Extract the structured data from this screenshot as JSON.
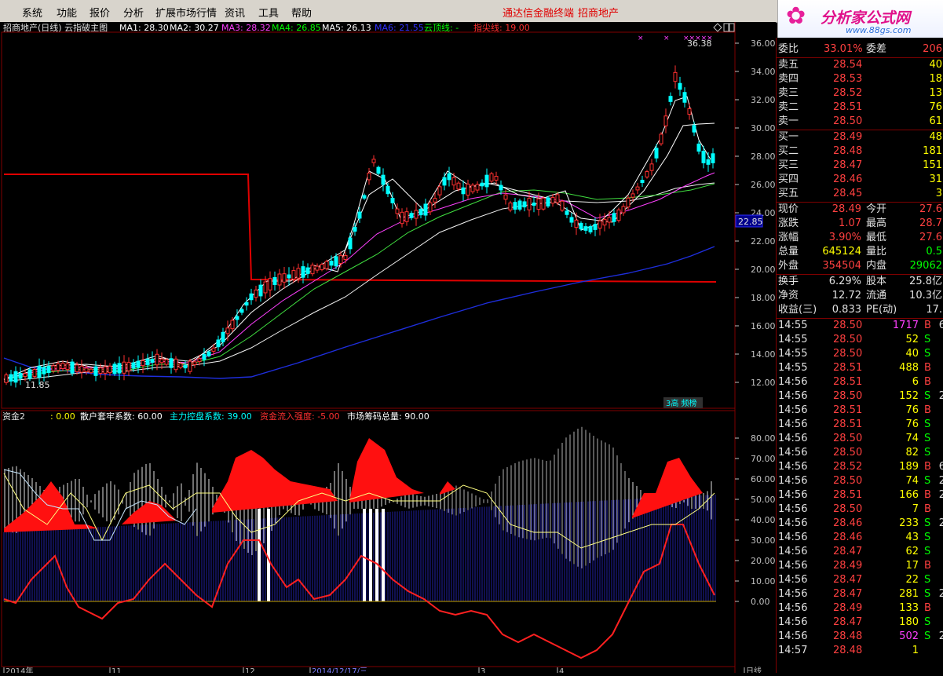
{
  "menu": {
    "items": [
      "系统",
      "功能",
      "报价",
      "分析",
      "扩展市场行情",
      "资讯",
      "工具",
      "帮助"
    ],
    "promo1": "通达信金融终端",
    "promo2": "招商地产"
  },
  "logo": {
    "brand": "分析家公式网",
    "url": "www.88gs.com"
  },
  "main_chart": {
    "title": "招商地产(日线) 云指破主图",
    "ma_labels": [
      {
        "text": "MA1: 28.30",
        "color": "#ffffff"
      },
      {
        "text": "MA2: 30.27",
        "color": "#ffffff"
      },
      {
        "text": "MA3: 28.32",
        "color": "#ff40ff"
      },
      {
        "text": "MA4: 26.85",
        "color": "#00ff00"
      },
      {
        "text": "MA5: 26.13",
        "color": "#ffffff"
      },
      {
        "text": "MA6: 21.55",
        "color": "#3030ff"
      },
      {
        "text": "云顶线: -",
        "color": "#00ff00"
      },
      {
        "text": "指尖线: 19.00",
        "color": "#ff3030"
      }
    ],
    "price_ticks": [
      "36.00",
      "34.00",
      "32.00",
      "30.00",
      "28.00",
      "26.00",
      "24.00",
      "22.00",
      "20.00",
      "18.00",
      "16.00",
      "14.00",
      "12.00"
    ],
    "high_label": "36.38",
    "low_label": "11.85",
    "current_tag": "22.85",
    "badge": "3高 频榜"
  },
  "sub_chart": {
    "title": "资金2",
    "labels": [
      {
        "text": ": 0.00",
        "color": "#ffff00"
      },
      {
        "text": "散户套牢系数: 60.00",
        "color": "#ffffff"
      },
      {
        "text": "主力控盘系数: 39.00",
        "color": "#00ffff"
      },
      {
        "text": "资金流入强度: -5.00",
        "color": "#ff3030"
      },
      {
        "text": "市场筹码总量: 90.00",
        "color": "#ffffff"
      }
    ],
    "ticks": [
      "80.00",
      "70.00",
      "60.00",
      "50.00",
      "40.00",
      "30.00",
      "20.00",
      "10.00",
      "0.00"
    ]
  },
  "bottom_axis": {
    "labels": [
      "2014年",
      "11",
      "12",
      "2014/12/17/三",
      "3",
      "4",
      "日线"
    ]
  },
  "quote": {
    "header": {
      "l1": "委比",
      "v1": "33.01%",
      "l2": "委差",
      "v2": "206"
    },
    "sell": [
      {
        "label": "卖五",
        "price": "28.54",
        "vol": "40"
      },
      {
        "label": "卖四",
        "price": "28.53",
        "vol": "18"
      },
      {
        "label": "卖三",
        "price": "28.52",
        "vol": "13"
      },
      {
        "label": "卖二",
        "price": "28.51",
        "vol": "76"
      },
      {
        "label": "卖一",
        "price": "28.50",
        "vol": "61"
      }
    ],
    "buy": [
      {
        "label": "买一",
        "price": "28.49",
        "vol": "48"
      },
      {
        "label": "买二",
        "price": "28.48",
        "vol": "181"
      },
      {
        "label": "买三",
        "price": "28.47",
        "vol": "151"
      },
      {
        "label": "买四",
        "price": "28.46",
        "vol": "31"
      },
      {
        "label": "买五",
        "price": "28.45",
        "vol": "3"
      }
    ],
    "stats1": [
      {
        "l1": "现价",
        "v1": "28.49",
        "c1": "red",
        "l2": "今开",
        "v2": "27.6",
        "c2": "red"
      },
      {
        "l1": "涨跌",
        "v1": "1.07",
        "c1": "red",
        "l2": "最高",
        "v2": "28.7",
        "c2": "red"
      },
      {
        "l1": "涨幅",
        "v1": "3.90%",
        "c1": "red",
        "l2": "最低",
        "v2": "27.6",
        "c2": "red"
      },
      {
        "l1": "总量",
        "v1": "645124",
        "c1": "yellow",
        "l2": "量比",
        "v2": "0.5",
        "c2": "green"
      },
      {
        "l1": "外盘",
        "v1": "354504",
        "c1": "red",
        "l2": "内盘",
        "v2": "29062",
        "c2": "green"
      }
    ],
    "stats2": [
      {
        "l1": "换手",
        "v1": "6.29%",
        "l2": "股本",
        "v2": "25.8亿"
      },
      {
        "l1": "净资",
        "v1": "12.72",
        "l2": "流通",
        "v2": "10.3亿"
      },
      {
        "l1": "收益(三)",
        "v1": "0.833",
        "l2": "PE(动)",
        "v2": "17."
      }
    ],
    "ticks": [
      {
        "t": "14:55",
        "p": "28.50",
        "v": "1717",
        "s": "B",
        "n": "6",
        "vc": "magenta"
      },
      {
        "t": "14:55",
        "p": "28.50",
        "v": "52",
        "s": "S",
        "n": "",
        "vc": "yellow"
      },
      {
        "t": "14:55",
        "p": "28.50",
        "v": "40",
        "s": "S",
        "n": "",
        "vc": "yellow"
      },
      {
        "t": "14:55",
        "p": "28.51",
        "v": "488",
        "s": "B",
        "n": "",
        "vc": "yellow"
      },
      {
        "t": "14:56",
        "p": "28.51",
        "v": "6",
        "s": "B",
        "n": "",
        "vc": "yellow"
      },
      {
        "t": "14:56",
        "p": "28.50",
        "v": "152",
        "s": "S",
        "n": "2",
        "vc": "yellow"
      },
      {
        "t": "14:56",
        "p": "28.51",
        "v": "76",
        "s": "B",
        "n": "",
        "vc": "yellow"
      },
      {
        "t": "14:56",
        "p": "28.51",
        "v": "76",
        "s": "S",
        "n": "",
        "vc": "yellow"
      },
      {
        "t": "14:56",
        "p": "28.50",
        "v": "74",
        "s": "S",
        "n": "",
        "vc": "yellow"
      },
      {
        "t": "14:56",
        "p": "28.50",
        "v": "82",
        "s": "S",
        "n": "",
        "vc": "yellow"
      },
      {
        "t": "14:56",
        "p": "28.52",
        "v": "189",
        "s": "B",
        "n": "6",
        "vc": "yellow"
      },
      {
        "t": "14:56",
        "p": "28.50",
        "v": "74",
        "s": "S",
        "n": "2",
        "vc": "yellow"
      },
      {
        "t": "14:56",
        "p": "28.51",
        "v": "166",
        "s": "B",
        "n": "2",
        "vc": "yellow"
      },
      {
        "t": "14:56",
        "p": "28.50",
        "v": "7",
        "s": "B",
        "n": "",
        "vc": "yellow"
      },
      {
        "t": "14:56",
        "p": "28.46",
        "v": "233",
        "s": "S",
        "n": "2",
        "vc": "yellow"
      },
      {
        "t": "14:56",
        "p": "28.46",
        "v": "43",
        "s": "S",
        "n": "",
        "vc": "yellow"
      },
      {
        "t": "14:56",
        "p": "28.47",
        "v": "62",
        "s": "S",
        "n": "",
        "vc": "yellow"
      },
      {
        "t": "14:56",
        "p": "28.49",
        "v": "17",
        "s": "B",
        "n": "",
        "vc": "yellow"
      },
      {
        "t": "14:56",
        "p": "28.47",
        "v": "22",
        "s": "S",
        "n": "",
        "vc": "yellow"
      },
      {
        "t": "14:56",
        "p": "28.47",
        "v": "281",
        "s": "S",
        "n": "2",
        "vc": "yellow"
      },
      {
        "t": "14:56",
        "p": "28.49",
        "v": "133",
        "s": "B",
        "n": "",
        "vc": "yellow"
      },
      {
        "t": "14:56",
        "p": "28.47",
        "v": "180",
        "s": "S",
        "n": "",
        "vc": "yellow"
      },
      {
        "t": "14:56",
        "p": "28.48",
        "v": "502",
        "s": "S",
        "n": "2",
        "vc": "magenta"
      },
      {
        "t": "14:57",
        "p": "28.48",
        "v": "1",
        "s": "",
        "n": "",
        "vc": "yellow"
      }
    ]
  },
  "colors": {
    "up": "#ff3030",
    "down": "#00ffff",
    "grid": "#800000",
    "axis": "#c0c0c0"
  }
}
